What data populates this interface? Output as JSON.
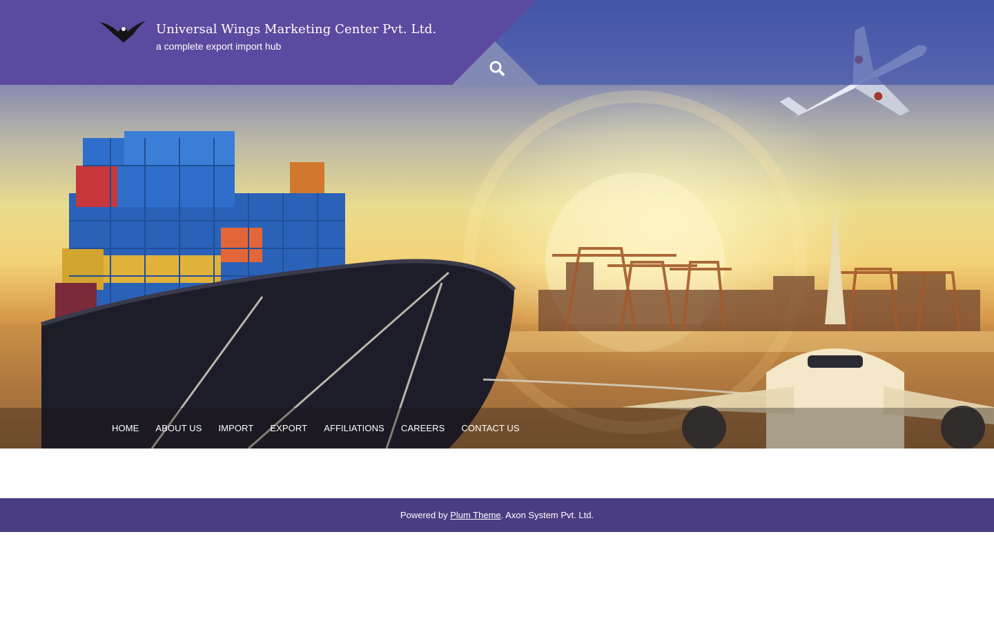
{
  "header": {
    "site_title": "Universal Wings Marketing Center Pvt. Ltd.",
    "tagline": "a complete export import hub",
    "logo_icon": "eagle-logo-icon",
    "search_icon": "search-icon"
  },
  "nav": {
    "items": [
      {
        "label": "HOME"
      },
      {
        "label": "ABOUT US"
      },
      {
        "label": "IMPORT"
      },
      {
        "label": "EXPORT"
      },
      {
        "label": "AFFILIATIONS"
      },
      {
        "label": "CAREERS"
      },
      {
        "label": "CONTACT US"
      }
    ]
  },
  "footer": {
    "powered_by_prefix": "Powered by ",
    "theme_link": "Plum Theme",
    "suffix": ". Axon System Pvt. Ltd."
  },
  "colors": {
    "header_purple": "#5b4a9f",
    "footer_purple": "#4b3d83",
    "text": "#ffffff"
  }
}
